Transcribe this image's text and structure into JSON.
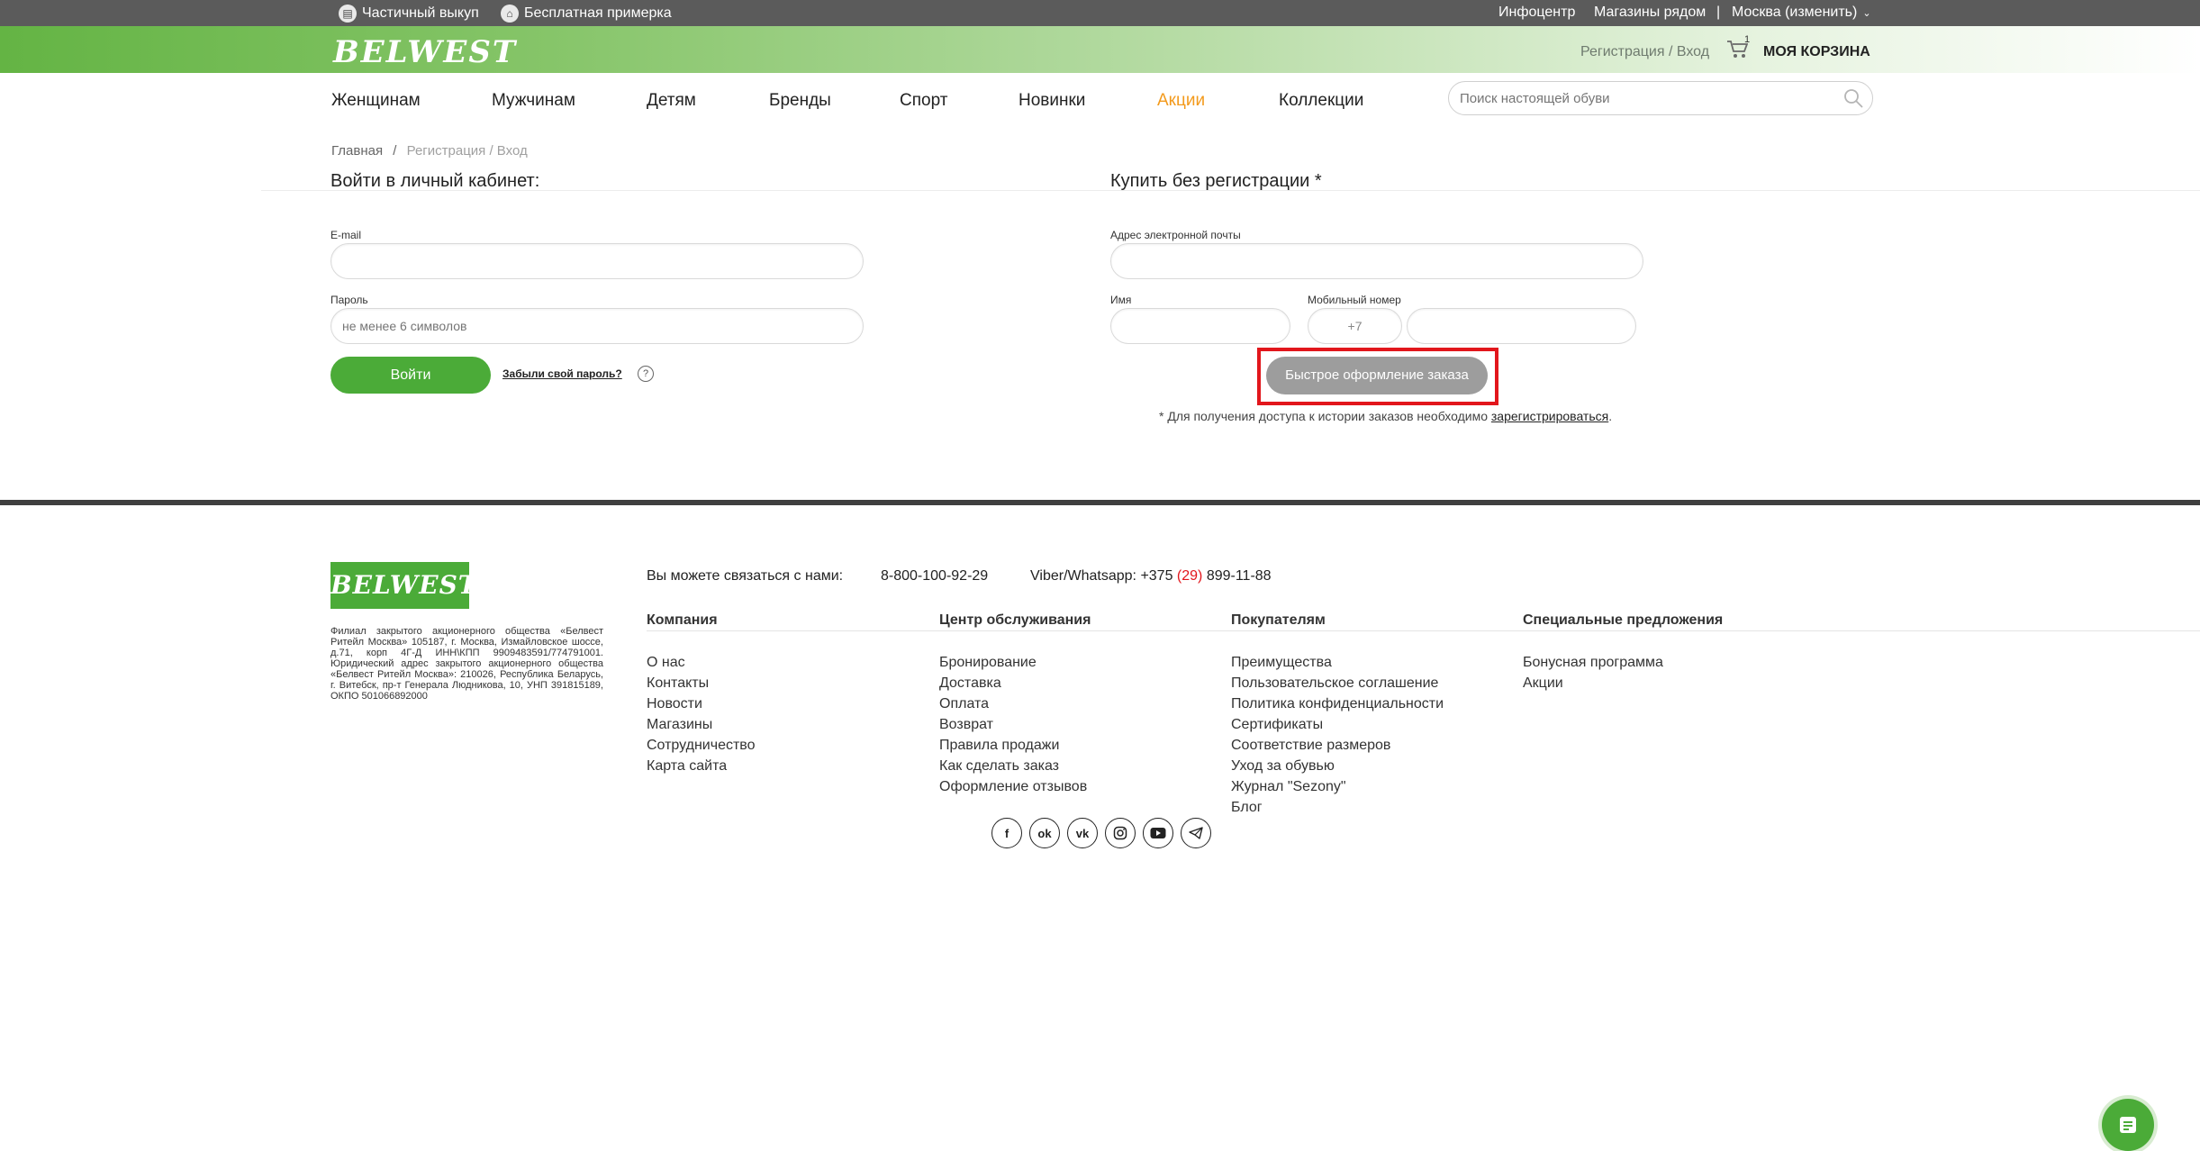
{
  "topbar": {
    "left": [
      {
        "label": "Частичный выкуп",
        "icon": "partial-buyout-icon"
      },
      {
        "label": "Бесплатная примерка",
        "icon": "free-fitting-icon"
      }
    ],
    "right": [
      "Инфоцентр",
      "Магазины рядом",
      "|",
      "Москва (изменить)"
    ]
  },
  "header": {
    "logo": "BELWEST",
    "reg_link": "Регистрация / Вход",
    "cart_count": "1",
    "cart_label": "МОЯ КОРЗИНА"
  },
  "nav": {
    "items": [
      "Женщинам",
      "Мужчинам",
      "Детям",
      "Бренды",
      "Спорт",
      "Новинки",
      "Акции",
      "Коллекции"
    ],
    "search_placeholder": "Поиск настоящей обуви"
  },
  "breadcrumbs": {
    "home": "Главная",
    "sep": "/",
    "current": "Регистрация / Вход"
  },
  "login": {
    "title": "Войти в личный кабинет:",
    "email_label": "E-mail",
    "password_label": "Пароль",
    "password_placeholder": "не менее 6 символов",
    "button": "Войти",
    "forgot": "Забыли свой пароль?",
    "help": "?"
  },
  "quick": {
    "title": "Купить без регистрации *",
    "email_label": "Адрес электронной почты",
    "name_label": "Имя",
    "phone_label": "Мобильный номер",
    "phone_prefix": "+7",
    "button": "Быстрое оформление заказа",
    "note_text": "* Для получения доступа к истории заказов необходимо ",
    "note_link": "зарегистрироваться",
    "note_end": "."
  },
  "footer": {
    "logo": "BELWEST",
    "legal": "Филиал закрытого акционерного общества «Белвест Ритейл Москва» 105187, г. Москва, Измайловское шоссе, д.71, корп 4Г-Д ИНН\\КПП 9909483591/774791001. Юридический адрес закрытого акционерного общества «Белвест Ритейл Москва»: 210026, Республика Беларусь, г. Витебск, пр-т Генерала Людникова, 10, УНП 391815189, ОКПО 501066892000",
    "contact_label": "Вы можете связаться с нами:",
    "phone": "8-800-100-92-29",
    "viber_prefix": "Viber/Whatsapp: +375 ",
    "viber_code": "(29)",
    "viber_rest": " 899-11-88",
    "accent_red": "#e2161c",
    "columns": [
      {
        "title": "Компания",
        "links": [
          "О нас",
          "Контакты",
          "Новости",
          "Магазины",
          "Сотрудничество",
          "Карта сайта"
        ]
      },
      {
        "title": "Центр обслуживания",
        "links": [
          "Бронирование",
          "Доставка",
          "Оплата",
          "Возврат",
          "Правила продажи",
          "Как сделать заказ",
          "Оформление отзывов"
        ]
      },
      {
        "title": "Покупателям",
        "links": [
          "Преимущества",
          "Пользовательское соглашение",
          "Политика конфиденциальности",
          "Сертификаты",
          "Соответствие размеров",
          "Уход за обувью",
          "Журнал \"Sezony\"",
          "Блог"
        ]
      },
      {
        "title": "Специальные предложения",
        "links": [
          "Бонусная программа",
          "Акции"
        ]
      }
    ],
    "social": [
      "facebook-icon",
      "odnoklassniki-icon",
      "vk-icon",
      "instagram-icon",
      "youtube-icon",
      "telegram-icon"
    ]
  },
  "colors": {
    "brand_green": "#4bab38",
    "sale_orange": "#f39a1c",
    "topbar_gray": "#5b5b5b"
  }
}
